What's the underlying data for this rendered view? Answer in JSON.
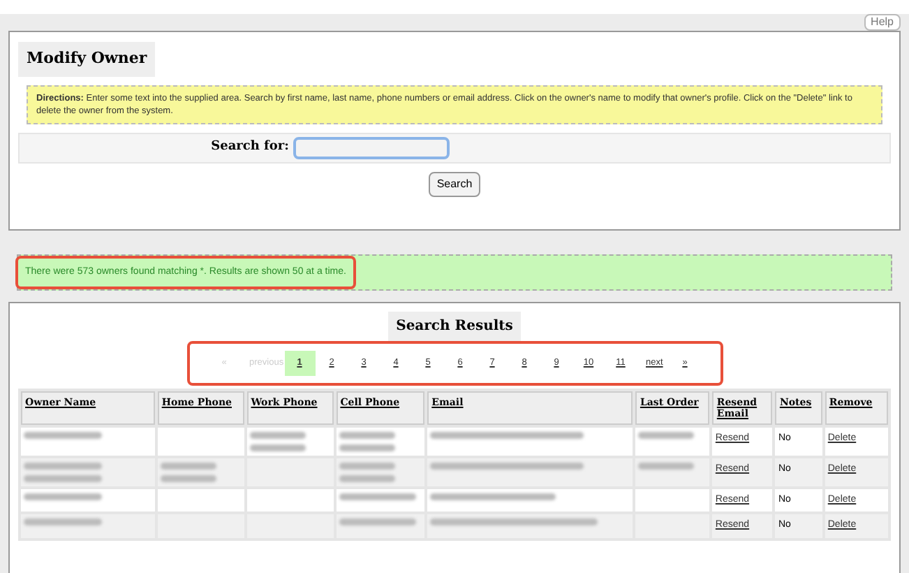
{
  "help_button": "Help",
  "title": "Modify Owner",
  "directions": "**Directions:** Enter some text into the supplied area. Search by first name, last name, phone numbers or email address. Click on the owner's name to modify that owner's profile. Click on the \"Delete\" link to delete the owner from the system.",
  "search": {
    "label": "Search for:",
    "button": "Search"
  },
  "message": "There were 573 owners found matching *. Results are shown 50 at a time.",
  "results_title": "Search Results",
  "pagination": [
    {
      "label": "«",
      "selected": false,
      "disabled": true
    },
    {
      "label": "previous",
      "selected": false,
      "disabled": true
    },
    {
      "label": "1",
      "selected": true,
      "disabled": false
    },
    {
      "label": "2",
      "selected": false,
      "disabled": false
    },
    {
      "label": "3",
      "selected": false,
      "disabled": false
    },
    {
      "label": "4",
      "selected": false,
      "disabled": false
    },
    {
      "label": "5",
      "selected": false,
      "disabled": false
    },
    {
      "label": "6",
      "selected": false,
      "disabled": false
    },
    {
      "label": "7",
      "selected": false,
      "disabled": false
    },
    {
      "label": "8",
      "selected": false,
      "disabled": false
    },
    {
      "label": "9",
      "selected": false,
      "disabled": false
    },
    {
      "label": "10",
      "selected": false,
      "disabled": false
    },
    {
      "label": "11",
      "selected": false,
      "disabled": false
    },
    {
      "label": "next",
      "selected": false,
      "disabled": false
    },
    {
      "label": "»",
      "selected": false,
      "disabled": false
    }
  ],
  "table": {
    "columns": [
      "Owner Name",
      "Home Phone",
      "Work Phone",
      "Cell Phone",
      "Email",
      "Last Order",
      "Resend Email",
      "Notes",
      "Remove"
    ],
    "rows": [
      {
        "resend": "Resend",
        "notes": "No",
        "remove": "Delete"
      },
      {
        "resend": "Resend",
        "notes": "No",
        "remove": "Delete"
      },
      {
        "resend": "Resend",
        "notes": "No",
        "remove": "Delete"
      },
      {
        "resend": "Resend",
        "notes": "No",
        "remove": "Delete"
      }
    ]
  }
}
